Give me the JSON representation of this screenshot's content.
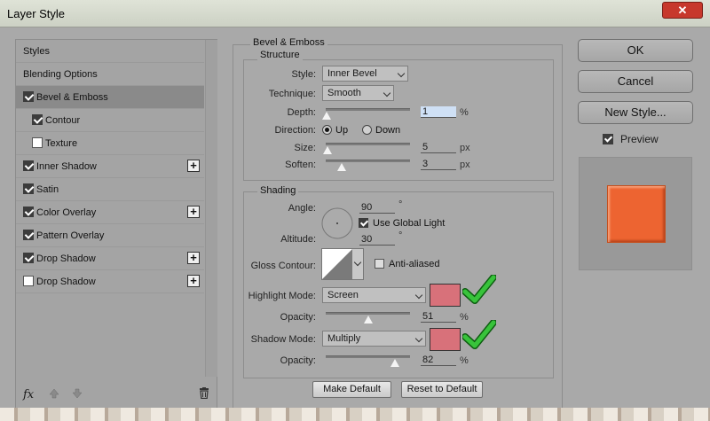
{
  "window": {
    "title": "Layer Style",
    "close_icon": "close-icon"
  },
  "sidebar": {
    "items": [
      {
        "label": "Styles",
        "checkbox": false,
        "checked": false,
        "plus": false,
        "indent": false,
        "selected": false
      },
      {
        "label": "Blending Options",
        "checkbox": false,
        "checked": false,
        "plus": false,
        "indent": false,
        "selected": false
      },
      {
        "label": "Bevel & Emboss",
        "checkbox": true,
        "checked": true,
        "plus": false,
        "indent": false,
        "selected": true
      },
      {
        "label": "Contour",
        "checkbox": true,
        "checked": true,
        "plus": false,
        "indent": true,
        "selected": false
      },
      {
        "label": "Texture",
        "checkbox": true,
        "checked": false,
        "plus": false,
        "indent": true,
        "selected": false
      },
      {
        "label": "Inner Shadow",
        "checkbox": true,
        "checked": true,
        "plus": true,
        "indent": false,
        "selected": false
      },
      {
        "label": "Satin",
        "checkbox": true,
        "checked": true,
        "plus": false,
        "indent": false,
        "selected": false
      },
      {
        "label": "Color Overlay",
        "checkbox": true,
        "checked": true,
        "plus": true,
        "indent": false,
        "selected": false
      },
      {
        "label": "Pattern Overlay",
        "checkbox": true,
        "checked": true,
        "plus": false,
        "indent": false,
        "selected": false
      },
      {
        "label": "Drop Shadow",
        "checkbox": true,
        "checked": true,
        "plus": true,
        "indent": false,
        "selected": false
      },
      {
        "label": "Drop Shadow",
        "checkbox": true,
        "checked": false,
        "plus": true,
        "indent": false,
        "selected": false
      }
    ],
    "footer": {
      "fx_label": "fx",
      "plus_symbol": "+"
    }
  },
  "bevel": {
    "section_title": "Bevel & Emboss",
    "structure": {
      "title": "Structure",
      "style_label": "Style:",
      "style_value": "Inner Bevel",
      "technique_label": "Technique:",
      "technique_value": "Smooth",
      "depth_label": "Depth:",
      "depth_value": "1",
      "depth_unit": "%",
      "depth_level": 0.01,
      "direction_label": "Direction:",
      "direction_up": "Up",
      "direction_down": "Down",
      "direction_selected": "Up",
      "size_label": "Size:",
      "size_value": "5",
      "size_unit": "px",
      "size_level": 0.02,
      "soften_label": "Soften:",
      "soften_value": "3",
      "soften_unit": "px",
      "soften_level": 0.19
    },
    "shading": {
      "title": "Shading",
      "angle_label": "Angle:",
      "angle_value": "90",
      "angle_unit": "°",
      "global_light_label": "Use Global Light",
      "global_light_checked": true,
      "altitude_label": "Altitude:",
      "altitude_value": "30",
      "altitude_unit": "°",
      "gloss_label": "Gloss Contour:",
      "anti_aliased_label": "Anti-aliased",
      "anti_aliased_checked": false,
      "highlight_label": "Highlight Mode:",
      "highlight_value": "Screen",
      "highlight_color": "#d8717a",
      "highlight_opacity_label": "Opacity:",
      "highlight_opacity_value": "51",
      "highlight_opacity_unit": "%",
      "highlight_opacity_level": 0.51,
      "shadow_label": "Shadow Mode:",
      "shadow_value": "Multiply",
      "shadow_color": "#d8717a",
      "shadow_opacity_label": "Opacity:",
      "shadow_opacity_value": "82",
      "shadow_opacity_unit": "%",
      "shadow_opacity_level": 0.82
    },
    "make_default": "Make Default",
    "reset_default": "Reset to Default"
  },
  "right": {
    "ok": "OK",
    "cancel": "Cancel",
    "new_style": "New Style...",
    "preview_label": "Preview",
    "preview_checked": true,
    "preview_color": "#ed6431"
  }
}
